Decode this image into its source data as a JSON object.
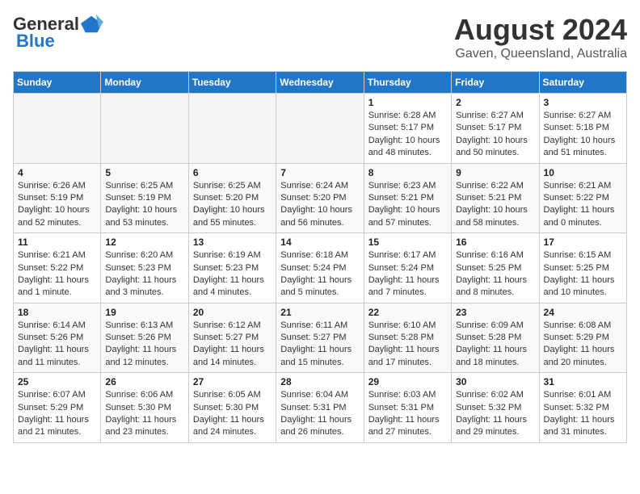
{
  "header": {
    "logo_general": "General",
    "logo_blue": "Blue",
    "month_year": "August 2024",
    "location": "Gaven, Queensland, Australia"
  },
  "calendar": {
    "days_of_week": [
      "Sunday",
      "Monday",
      "Tuesday",
      "Wednesday",
      "Thursday",
      "Friday",
      "Saturday"
    ],
    "weeks": [
      [
        {
          "day": "",
          "info": ""
        },
        {
          "day": "",
          "info": ""
        },
        {
          "day": "",
          "info": ""
        },
        {
          "day": "",
          "info": ""
        },
        {
          "day": "1",
          "info": "Sunrise: 6:28 AM\nSunset: 5:17 PM\nDaylight: 10 hours\nand 48 minutes."
        },
        {
          "day": "2",
          "info": "Sunrise: 6:27 AM\nSunset: 5:17 PM\nDaylight: 10 hours\nand 50 minutes."
        },
        {
          "day": "3",
          "info": "Sunrise: 6:27 AM\nSunset: 5:18 PM\nDaylight: 10 hours\nand 51 minutes."
        }
      ],
      [
        {
          "day": "4",
          "info": "Sunrise: 6:26 AM\nSunset: 5:19 PM\nDaylight: 10 hours\nand 52 minutes."
        },
        {
          "day": "5",
          "info": "Sunrise: 6:25 AM\nSunset: 5:19 PM\nDaylight: 10 hours\nand 53 minutes."
        },
        {
          "day": "6",
          "info": "Sunrise: 6:25 AM\nSunset: 5:20 PM\nDaylight: 10 hours\nand 55 minutes."
        },
        {
          "day": "7",
          "info": "Sunrise: 6:24 AM\nSunset: 5:20 PM\nDaylight: 10 hours\nand 56 minutes."
        },
        {
          "day": "8",
          "info": "Sunrise: 6:23 AM\nSunset: 5:21 PM\nDaylight: 10 hours\nand 57 minutes."
        },
        {
          "day": "9",
          "info": "Sunrise: 6:22 AM\nSunset: 5:21 PM\nDaylight: 10 hours\nand 58 minutes."
        },
        {
          "day": "10",
          "info": "Sunrise: 6:21 AM\nSunset: 5:22 PM\nDaylight: 11 hours\nand 0 minutes."
        }
      ],
      [
        {
          "day": "11",
          "info": "Sunrise: 6:21 AM\nSunset: 5:22 PM\nDaylight: 11 hours\nand 1 minute."
        },
        {
          "day": "12",
          "info": "Sunrise: 6:20 AM\nSunset: 5:23 PM\nDaylight: 11 hours\nand 3 minutes."
        },
        {
          "day": "13",
          "info": "Sunrise: 6:19 AM\nSunset: 5:23 PM\nDaylight: 11 hours\nand 4 minutes."
        },
        {
          "day": "14",
          "info": "Sunrise: 6:18 AM\nSunset: 5:24 PM\nDaylight: 11 hours\nand 5 minutes."
        },
        {
          "day": "15",
          "info": "Sunrise: 6:17 AM\nSunset: 5:24 PM\nDaylight: 11 hours\nand 7 minutes."
        },
        {
          "day": "16",
          "info": "Sunrise: 6:16 AM\nSunset: 5:25 PM\nDaylight: 11 hours\nand 8 minutes."
        },
        {
          "day": "17",
          "info": "Sunrise: 6:15 AM\nSunset: 5:25 PM\nDaylight: 11 hours\nand 10 minutes."
        }
      ],
      [
        {
          "day": "18",
          "info": "Sunrise: 6:14 AM\nSunset: 5:26 PM\nDaylight: 11 hours\nand 11 minutes."
        },
        {
          "day": "19",
          "info": "Sunrise: 6:13 AM\nSunset: 5:26 PM\nDaylight: 11 hours\nand 12 minutes."
        },
        {
          "day": "20",
          "info": "Sunrise: 6:12 AM\nSunset: 5:27 PM\nDaylight: 11 hours\nand 14 minutes."
        },
        {
          "day": "21",
          "info": "Sunrise: 6:11 AM\nSunset: 5:27 PM\nDaylight: 11 hours\nand 15 minutes."
        },
        {
          "day": "22",
          "info": "Sunrise: 6:10 AM\nSunset: 5:28 PM\nDaylight: 11 hours\nand 17 minutes."
        },
        {
          "day": "23",
          "info": "Sunrise: 6:09 AM\nSunset: 5:28 PM\nDaylight: 11 hours\nand 18 minutes."
        },
        {
          "day": "24",
          "info": "Sunrise: 6:08 AM\nSunset: 5:29 PM\nDaylight: 11 hours\nand 20 minutes."
        }
      ],
      [
        {
          "day": "25",
          "info": "Sunrise: 6:07 AM\nSunset: 5:29 PM\nDaylight: 11 hours\nand 21 minutes."
        },
        {
          "day": "26",
          "info": "Sunrise: 6:06 AM\nSunset: 5:30 PM\nDaylight: 11 hours\nand 23 minutes."
        },
        {
          "day": "27",
          "info": "Sunrise: 6:05 AM\nSunset: 5:30 PM\nDaylight: 11 hours\nand 24 minutes."
        },
        {
          "day": "28",
          "info": "Sunrise: 6:04 AM\nSunset: 5:31 PM\nDaylight: 11 hours\nand 26 minutes."
        },
        {
          "day": "29",
          "info": "Sunrise: 6:03 AM\nSunset: 5:31 PM\nDaylight: 11 hours\nand 27 minutes."
        },
        {
          "day": "30",
          "info": "Sunrise: 6:02 AM\nSunset: 5:32 PM\nDaylight: 11 hours\nand 29 minutes."
        },
        {
          "day": "31",
          "info": "Sunrise: 6:01 AM\nSunset: 5:32 PM\nDaylight: 11 hours\nand 31 minutes."
        }
      ]
    ]
  }
}
